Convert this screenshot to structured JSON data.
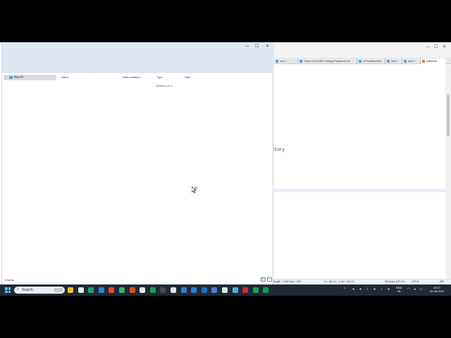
{
  "explorer": {
    "minimize": "—",
    "maximize": "☐",
    "close": "✕",
    "nav_item": "This PC",
    "columns": [
      "Name",
      "Date modified",
      "Type",
      "Size"
    ],
    "loading_text": "Working on it...",
    "status": "0 items"
  },
  "editor": {
    "minimize": "—",
    "maximize": "☐",
    "close": "✕",
    "tabs": [
      "new 1",
      "Oracle Core DBA Training Programme.txt",
      "iorPredefined.txt",
      "new 2",
      "new 3",
      "Latest.txt"
    ],
    "visible_text": "ctory",
    "status": {
      "length": "length : 1,499   lines : 294",
      "position": "Ln : 66   Col : 1   Sel : 132 | 6",
      "eol": "Windows (CR LF)",
      "encoding": "UTF-8",
      "mode": "INS"
    }
  },
  "taskbar": {
    "search_label": "Search",
    "lang_line1": "ENG",
    "lang_line2": "IN",
    "time": "19:17",
    "date": "03-08-2024",
    "app_colors": [
      "#f2c038",
      "#e5e5e5",
      "#22a06b",
      "#2f7fd6",
      "#e84a2f",
      "#2bb673",
      "#d9531e",
      "#e5e5e5",
      "#1f9d55",
      "#4a4a4a",
      "#e5e5e5",
      "#2f7fd6",
      "#2f7fd6",
      "#1e6fbf",
      "#4a7bd0",
      "#e5e5e5",
      "#4ab0e0",
      "#c83030",
      "#1f9d55",
      "#0f9d58"
    ]
  }
}
